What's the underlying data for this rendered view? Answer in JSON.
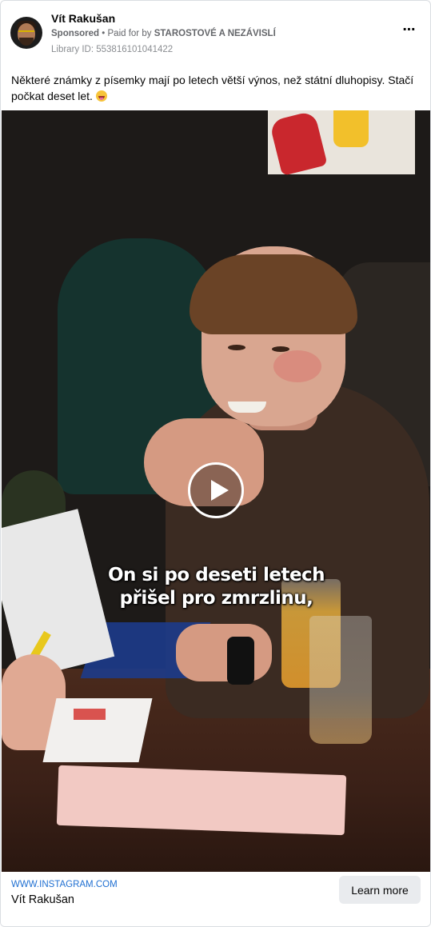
{
  "post": {
    "page_name": "Vít Rakušan",
    "sponsored_label": "Sponsored",
    "separator": "•",
    "paid_for_by_label": "Paid for by",
    "advertiser": "STAROSTOVÉ A NEZÁVISLÍ",
    "library_id": "Library ID: 553816101041422",
    "more_icon": "⋯",
    "body_text": "Některé známky z písemky mají po letech větší výnos, než státní dluhopisy. Stačí počkat deset let.",
    "body_emoji": "grinning-face-with-tongue-emoji"
  },
  "video": {
    "subtitle_line1": "On si po deseti letech",
    "subtitle_line2": "přišel pro zmrzlinu,",
    "play_icon": "play-icon"
  },
  "footer": {
    "link_domain": "WWW.INSTAGRAM.COM",
    "link_title": "Vít Rakušan",
    "cta_label": "Learn more"
  }
}
